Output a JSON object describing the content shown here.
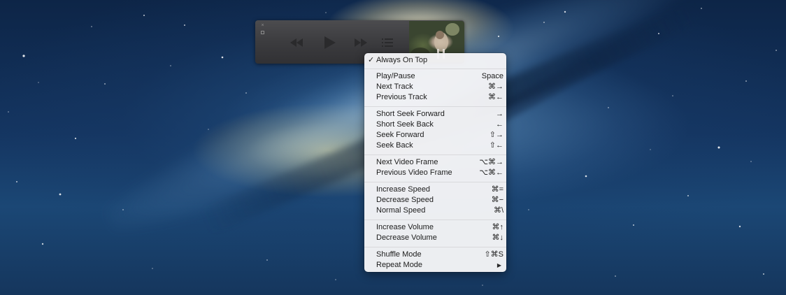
{
  "player": {
    "artwork_alt": "album-artwork"
  },
  "menu": {
    "items": [
      {
        "label": "Always On Top",
        "shortcut": "",
        "checked": true
      },
      {
        "label": "Play/Pause",
        "shortcut": "Space"
      },
      {
        "label": "Next Track",
        "shortcut": "⌘→"
      },
      {
        "label": "Previous Track",
        "shortcut": "⌘←"
      },
      {
        "label": "Short Seek Forward",
        "shortcut": "→"
      },
      {
        "label": "Short Seek Back",
        "shortcut": "←"
      },
      {
        "label": "Seek Forward",
        "shortcut": "⇧→"
      },
      {
        "label": "Seek Back",
        "shortcut": "⇧←"
      },
      {
        "label": "Next Video Frame",
        "shortcut": "⌥⌘→"
      },
      {
        "label": "Previous Video Frame",
        "shortcut": "⌥⌘←"
      },
      {
        "label": "Increase Speed",
        "shortcut": "⌘="
      },
      {
        "label": "Decrease Speed",
        "shortcut": "⌘−"
      },
      {
        "label": "Normal Speed",
        "shortcut": "⌘\\"
      },
      {
        "label": "Increase Volume",
        "shortcut": "⌘↑"
      },
      {
        "label": "Decrease Volume",
        "shortcut": "⌘↓"
      },
      {
        "label": "Shuffle Mode",
        "shortcut": "⇧⌘S"
      },
      {
        "label": "Repeat Mode",
        "shortcut": ""
      }
    ],
    "checkmark": "✓",
    "submenu_arrow": "▶"
  },
  "colors": {
    "menu_background": "#f4f4f6",
    "player_background": "#3c3c3f",
    "desktop": "#143561"
  },
  "icons": {
    "rewind": "rewind-icon",
    "play": "play-icon",
    "fast_forward": "fast-forward-icon",
    "playlist": "playlist-icon",
    "close": "close-icon",
    "zoom": "zoom-icon"
  }
}
